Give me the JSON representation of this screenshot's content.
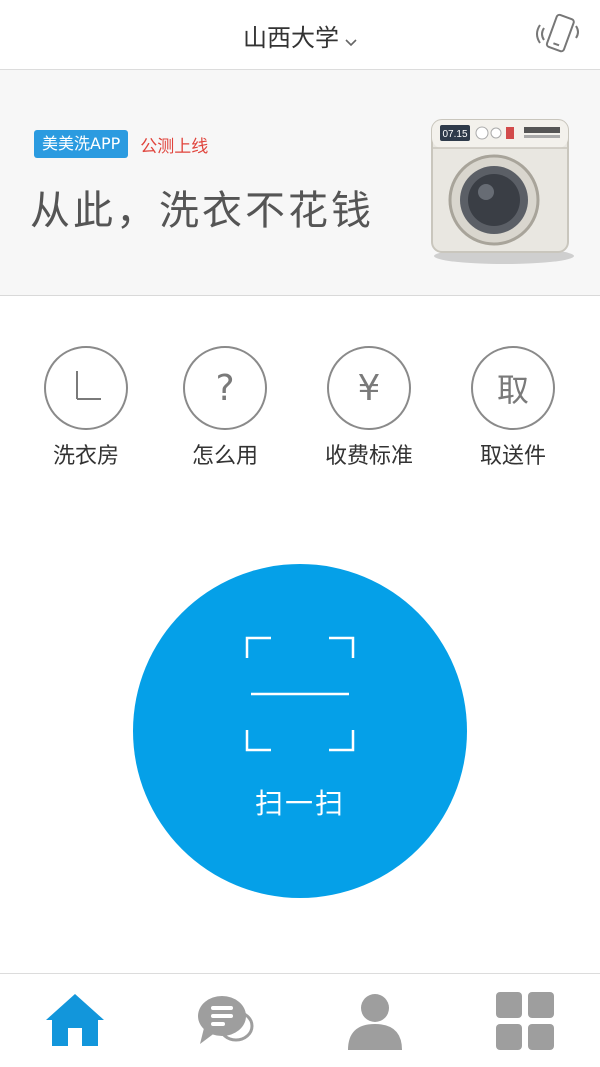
{
  "header": {
    "campus": "山西大学",
    "phone_icon": "phone-vibrate-icon",
    "caret_icon": "chevron-down-icon"
  },
  "banner": {
    "app_badge": "美美洗APP",
    "beta_text": "公测上线",
    "slogan": "从此，洗衣不花钱",
    "washer_display": "07.15",
    "image": "washing-machine-illustration"
  },
  "quick_actions": [
    {
      "label": "洗衣房",
      "icon": "clock-icon",
      "glyph": ""
    },
    {
      "label": "怎么用",
      "icon": "question-icon",
      "glyph": "?"
    },
    {
      "label": "收费标准",
      "icon": "yen-icon",
      "glyph": "¥"
    },
    {
      "label": "取送件",
      "icon": "pickup-icon",
      "glyph": "取"
    }
  ],
  "scan": {
    "label": "扫一扫",
    "icon": "scan-frame-icon",
    "color": "#05a0e8"
  },
  "tabbar": {
    "items": [
      {
        "name": "home",
        "icon": "home-icon",
        "active": true
      },
      {
        "name": "messages",
        "icon": "chat-bubble-icon",
        "active": false
      },
      {
        "name": "profile",
        "icon": "user-icon",
        "active": false
      },
      {
        "name": "more",
        "icon": "grid-icon",
        "active": false
      }
    ],
    "active_color": "#1296db",
    "inactive_color": "#9e9e9e"
  }
}
